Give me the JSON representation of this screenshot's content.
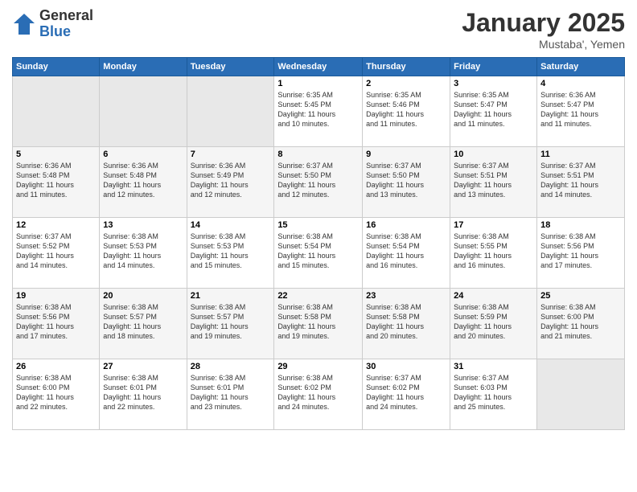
{
  "logo": {
    "general": "General",
    "blue": "Blue"
  },
  "title": "January 2025",
  "location": "Mustaba', Yemen",
  "days_of_week": [
    "Sunday",
    "Monday",
    "Tuesday",
    "Wednesday",
    "Thursday",
    "Friday",
    "Saturday"
  ],
  "weeks": [
    [
      {
        "day": "",
        "info": ""
      },
      {
        "day": "",
        "info": ""
      },
      {
        "day": "",
        "info": ""
      },
      {
        "day": "1",
        "info": "Sunrise: 6:35 AM\nSunset: 5:45 PM\nDaylight: 11 hours\nand 10 minutes."
      },
      {
        "day": "2",
        "info": "Sunrise: 6:35 AM\nSunset: 5:46 PM\nDaylight: 11 hours\nand 11 minutes."
      },
      {
        "day": "3",
        "info": "Sunrise: 6:35 AM\nSunset: 5:47 PM\nDaylight: 11 hours\nand 11 minutes."
      },
      {
        "day": "4",
        "info": "Sunrise: 6:36 AM\nSunset: 5:47 PM\nDaylight: 11 hours\nand 11 minutes."
      }
    ],
    [
      {
        "day": "5",
        "info": "Sunrise: 6:36 AM\nSunset: 5:48 PM\nDaylight: 11 hours\nand 11 minutes."
      },
      {
        "day": "6",
        "info": "Sunrise: 6:36 AM\nSunset: 5:48 PM\nDaylight: 11 hours\nand 12 minutes."
      },
      {
        "day": "7",
        "info": "Sunrise: 6:36 AM\nSunset: 5:49 PM\nDaylight: 11 hours\nand 12 minutes."
      },
      {
        "day": "8",
        "info": "Sunrise: 6:37 AM\nSunset: 5:50 PM\nDaylight: 11 hours\nand 12 minutes."
      },
      {
        "day": "9",
        "info": "Sunrise: 6:37 AM\nSunset: 5:50 PM\nDaylight: 11 hours\nand 13 minutes."
      },
      {
        "day": "10",
        "info": "Sunrise: 6:37 AM\nSunset: 5:51 PM\nDaylight: 11 hours\nand 13 minutes."
      },
      {
        "day": "11",
        "info": "Sunrise: 6:37 AM\nSunset: 5:51 PM\nDaylight: 11 hours\nand 14 minutes."
      }
    ],
    [
      {
        "day": "12",
        "info": "Sunrise: 6:37 AM\nSunset: 5:52 PM\nDaylight: 11 hours\nand 14 minutes."
      },
      {
        "day": "13",
        "info": "Sunrise: 6:38 AM\nSunset: 5:53 PM\nDaylight: 11 hours\nand 14 minutes."
      },
      {
        "day": "14",
        "info": "Sunrise: 6:38 AM\nSunset: 5:53 PM\nDaylight: 11 hours\nand 15 minutes."
      },
      {
        "day": "15",
        "info": "Sunrise: 6:38 AM\nSunset: 5:54 PM\nDaylight: 11 hours\nand 15 minutes."
      },
      {
        "day": "16",
        "info": "Sunrise: 6:38 AM\nSunset: 5:54 PM\nDaylight: 11 hours\nand 16 minutes."
      },
      {
        "day": "17",
        "info": "Sunrise: 6:38 AM\nSunset: 5:55 PM\nDaylight: 11 hours\nand 16 minutes."
      },
      {
        "day": "18",
        "info": "Sunrise: 6:38 AM\nSunset: 5:56 PM\nDaylight: 11 hours\nand 17 minutes."
      }
    ],
    [
      {
        "day": "19",
        "info": "Sunrise: 6:38 AM\nSunset: 5:56 PM\nDaylight: 11 hours\nand 17 minutes."
      },
      {
        "day": "20",
        "info": "Sunrise: 6:38 AM\nSunset: 5:57 PM\nDaylight: 11 hours\nand 18 minutes."
      },
      {
        "day": "21",
        "info": "Sunrise: 6:38 AM\nSunset: 5:57 PM\nDaylight: 11 hours\nand 19 minutes."
      },
      {
        "day": "22",
        "info": "Sunrise: 6:38 AM\nSunset: 5:58 PM\nDaylight: 11 hours\nand 19 minutes."
      },
      {
        "day": "23",
        "info": "Sunrise: 6:38 AM\nSunset: 5:58 PM\nDaylight: 11 hours\nand 20 minutes."
      },
      {
        "day": "24",
        "info": "Sunrise: 6:38 AM\nSunset: 5:59 PM\nDaylight: 11 hours\nand 20 minutes."
      },
      {
        "day": "25",
        "info": "Sunrise: 6:38 AM\nSunset: 6:00 PM\nDaylight: 11 hours\nand 21 minutes."
      }
    ],
    [
      {
        "day": "26",
        "info": "Sunrise: 6:38 AM\nSunset: 6:00 PM\nDaylight: 11 hours\nand 22 minutes."
      },
      {
        "day": "27",
        "info": "Sunrise: 6:38 AM\nSunset: 6:01 PM\nDaylight: 11 hours\nand 22 minutes."
      },
      {
        "day": "28",
        "info": "Sunrise: 6:38 AM\nSunset: 6:01 PM\nDaylight: 11 hours\nand 23 minutes."
      },
      {
        "day": "29",
        "info": "Sunrise: 6:38 AM\nSunset: 6:02 PM\nDaylight: 11 hours\nand 24 minutes."
      },
      {
        "day": "30",
        "info": "Sunrise: 6:37 AM\nSunset: 6:02 PM\nDaylight: 11 hours\nand 24 minutes."
      },
      {
        "day": "31",
        "info": "Sunrise: 6:37 AM\nSunset: 6:03 PM\nDaylight: 11 hours\nand 25 minutes."
      },
      {
        "day": "",
        "info": ""
      }
    ]
  ]
}
